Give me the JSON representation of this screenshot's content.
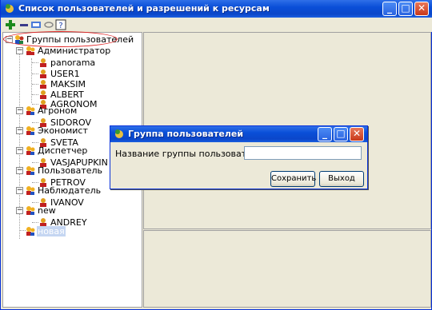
{
  "window": {
    "title": "Список пользователей и разрешений к ресурсам",
    "buttons": {
      "minimize": "_",
      "maximize": "□",
      "close": "✕"
    }
  },
  "toolbar": {
    "icons": [
      "add-icon",
      "remove-icon",
      "edit-icon",
      "link-icon",
      "help-icon"
    ]
  },
  "tree": {
    "root": "Группы пользователей",
    "groups": [
      {
        "label": "Администратор",
        "users": [
          "panorama",
          "USER1",
          "MAKSIM",
          "ALBERT",
          "AGRONOM"
        ]
      },
      {
        "label": "Агроном",
        "users": [
          "SIDOROV"
        ]
      },
      {
        "label": "Экономист",
        "users": [
          "SVETA"
        ]
      },
      {
        "label": "Диспетчер",
        "users": [
          "VASJAPUPKIN"
        ]
      },
      {
        "label": "Пользователь",
        "users": [
          "PETROV"
        ]
      },
      {
        "label": "Наблюдатель",
        "users": [
          "IVANOV"
        ]
      },
      {
        "label": "new",
        "users": [
          "ANDREY"
        ]
      },
      {
        "label": "новая",
        "users": []
      }
    ]
  },
  "dialog": {
    "title": "Группа пользователей",
    "field_label": "Название группы пользователей",
    "field_value": "",
    "save_label": "Сохранить",
    "exit_label": "Выход"
  },
  "colors": {
    "titlebar": "#0b46c9",
    "selection": "#c5d6f2",
    "annotation": "#e02020"
  }
}
